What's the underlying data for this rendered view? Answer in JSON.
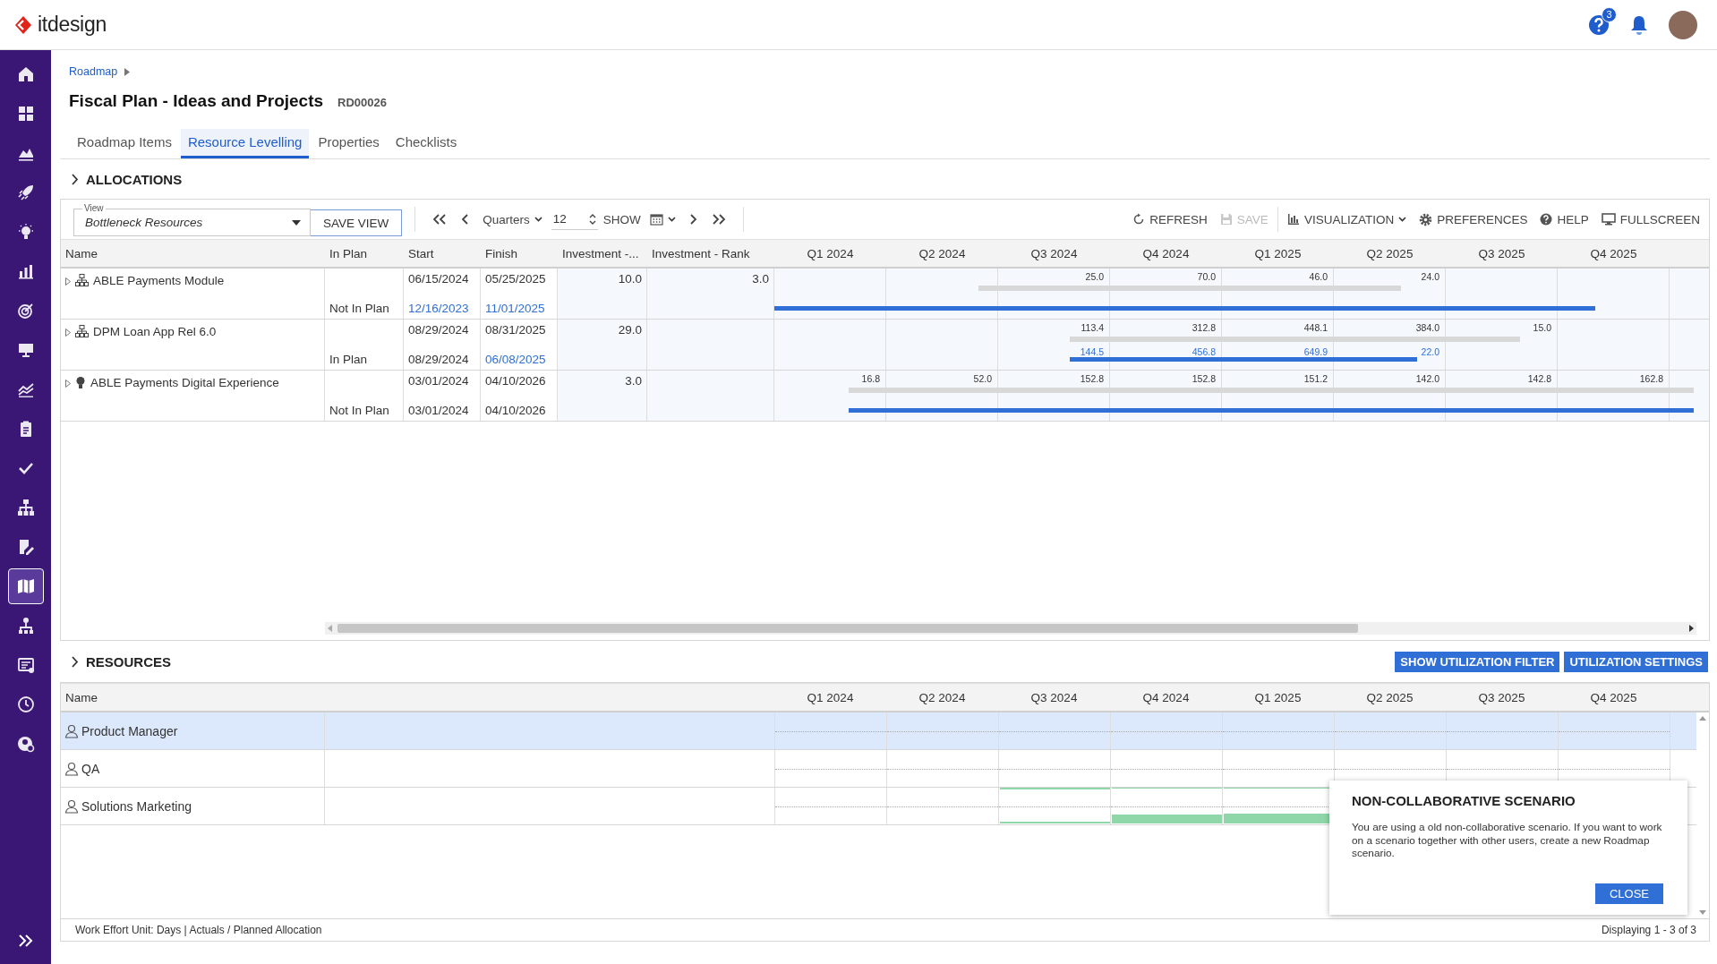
{
  "header": {
    "logo": "itdesign",
    "help_badge": "3"
  },
  "sidebar": {
    "items": [
      {
        "kind": "home",
        "selected": false
      },
      {
        "kind": "grid",
        "selected": false
      },
      {
        "kind": "area",
        "selected": false
      },
      {
        "kind": "rocket",
        "selected": false
      },
      {
        "kind": "bulb",
        "selected": false
      },
      {
        "kind": "bars",
        "selected": false
      },
      {
        "kind": "target",
        "selected": false
      },
      {
        "kind": "monitor",
        "selected": false
      },
      {
        "kind": "trend",
        "selected": false
      },
      {
        "kind": "clipboard",
        "selected": false
      },
      {
        "kind": "check",
        "selected": false
      },
      {
        "kind": "hierarchy",
        "selected": false
      },
      {
        "kind": "edit",
        "selected": false
      },
      {
        "kind": "map",
        "selected": true
      },
      {
        "kind": "org",
        "selected": false
      },
      {
        "kind": "list",
        "selected": false
      },
      {
        "kind": "clock",
        "selected": false
      },
      {
        "kind": "usergear",
        "selected": false
      }
    ]
  },
  "breadcrumb": [
    "Roadmap"
  ],
  "title": "Fiscal Plan - Ideas and Projects",
  "code": "RD00026",
  "tabs": [
    {
      "label": "Roadmap Items",
      "selected": false
    },
    {
      "label": "Resource Levelling",
      "selected": true
    },
    {
      "label": "Properties",
      "selected": false
    },
    {
      "label": "Checklists",
      "selected": false
    }
  ],
  "allocations": {
    "title": "ALLOCATIONS",
    "toolbar": {
      "view_label": "View",
      "view_value": "Bottleneck Resources",
      "save_view": "SAVE VIEW",
      "scale": "Quarters",
      "count": "12",
      "show": "SHOW",
      "actions": [
        {
          "kind": "refresh",
          "label": "REFRESH",
          "disabled": false
        },
        {
          "kind": "save",
          "label": "SAVE",
          "disabled": true
        },
        {
          "kind": "visualization",
          "label": "VISUALIZATION",
          "disabled": false
        },
        {
          "kind": "preferences",
          "label": "PREFERENCES",
          "disabled": false
        },
        {
          "kind": "help",
          "label": "HELP",
          "disabled": false
        },
        {
          "kind": "fullscreen",
          "label": "FULLSCREEN",
          "disabled": false
        }
      ]
    },
    "columns": [
      "Name",
      "In Plan",
      "Start",
      "Finish",
      "Investment -...",
      "Investment - Rank"
    ],
    "quarters": [
      "Q1 2024",
      "Q2 2024",
      "Q3 2024",
      "Q4 2024",
      "Q1 2025",
      "Q2 2025",
      "Q3 2025",
      "Q4 2025"
    ],
    "rows": [
      {
        "kind": "project",
        "name": "ABLE Payments Module",
        "in_plan": "Not In Plan",
        "start": "06/15/2024",
        "finish": "05/25/2025",
        "planned_start": {
          "text": "12/16/2023",
          "changed": true
        },
        "planned_finish": {
          "text": "11/01/2025",
          "changed": true
        },
        "investment": "10.0",
        "rank": "3.0",
        "cells": [
          {
            "kind": "blank"
          },
          {
            "kind": "blank"
          },
          {
            "kind": "effort",
            "value": "25.0"
          },
          {
            "kind": "effort",
            "value": "70.0"
          },
          {
            "kind": "effort",
            "value": "46.0"
          },
          {
            "kind": "effort",
            "value": "24.0"
          },
          {
            "kind": "blank"
          },
          {
            "kind": "blank"
          }
        ]
      },
      {
        "kind": "project",
        "name": "DPM Loan App Rel 6.0",
        "in_plan": "In Plan",
        "start": "08/29/2024",
        "finish": "08/31/2025",
        "planned_start": {
          "text": "08/29/2024",
          "changed": false
        },
        "planned_finish": {
          "text": "06/08/2025",
          "changed": true
        },
        "investment": "29.0",
        "cells": [
          {
            "kind": "blank"
          },
          {
            "kind": "blank"
          },
          {
            "kind": "effort",
            "value": "113.4",
            "planned": "144.5"
          },
          {
            "kind": "effort",
            "value": "312.8",
            "planned": "456.8"
          },
          {
            "kind": "effort",
            "value": "448.1",
            "planned": "649.9"
          },
          {
            "kind": "effort",
            "value": "384.0",
            "planned": "22.0"
          },
          {
            "kind": "effort",
            "value": "15.0"
          },
          {
            "kind": "blank"
          }
        ]
      },
      {
        "kind": "idea",
        "name": "ABLE Payments Digital Experience",
        "in_plan": "Not In Plan",
        "start": "03/01/2024",
        "finish": "04/10/2026",
        "planned_start": {
          "text": "03/01/2024",
          "changed": false
        },
        "planned_finish": {
          "text": "04/10/2026",
          "changed": false
        },
        "investment": "3.0",
        "cells": [
          {
            "kind": "effort",
            "value": "16.8"
          },
          {
            "kind": "effort",
            "value": "52.0"
          },
          {
            "kind": "effort",
            "value": "152.8"
          },
          {
            "kind": "effort",
            "value": "152.8"
          },
          {
            "kind": "effort",
            "value": "151.2"
          },
          {
            "kind": "effort",
            "value": "142.0"
          },
          {
            "kind": "effort",
            "value": "142.8"
          },
          {
            "kind": "effort",
            "value": "162.8"
          }
        ]
      }
    ]
  },
  "resources": {
    "title": "RESOURCES",
    "buttons": [
      "SHOW UTILIZATION FILTER",
      "UTILIZATION SETTINGS"
    ],
    "columns": [
      "Name"
    ],
    "quarters": [
      "Q1 2024",
      "Q2 2024",
      "Q3 2024",
      "Q4 2024",
      "Q1 2025",
      "Q2 2025",
      "Q3 2025",
      "Q4 2025"
    ],
    "rows": [
      {
        "kind": "unallocated",
        "name": "Product Manager",
        "selected": true
      },
      {
        "kind": "unallocated",
        "name": "QA",
        "selected": false
      },
      {
        "kind": "allocated",
        "name": "Solutions Marketing",
        "selected": false
      }
    ],
    "footer": "Work Effort Unit: Days | Actuals / Planned Allocation",
    "count": "Displaying 1 - 3 of 3"
  },
  "dialog": {
    "title": "NON-COLLABORATIVE SCENARIO",
    "text": "You are using a old non-collaborative scenario. If you want to work on a scenario together with other users, create a new Roadmap scenario.",
    "button": "CLOSE"
  }
}
